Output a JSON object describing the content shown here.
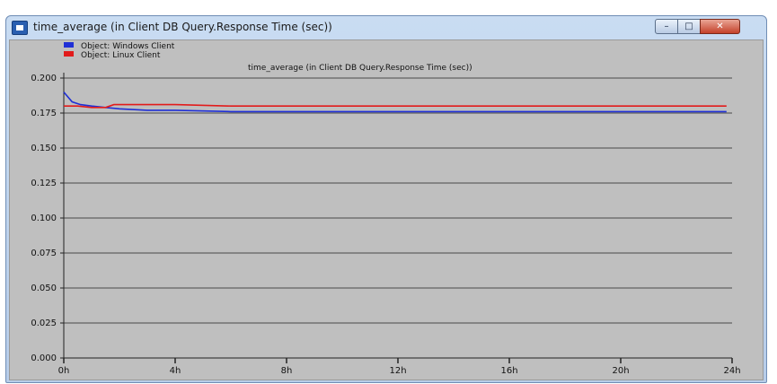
{
  "window": {
    "title": "time_average (in Client DB Query.Response Time (sec))",
    "buttons": {
      "minimize": "–",
      "maximize": "□",
      "close": "✕"
    },
    "icon": "app-icon"
  },
  "legend": [
    {
      "label": "Object: Windows Client",
      "color": "#1f2fd6"
    },
    {
      "label": "Object: Linux Client",
      "color": "#e21b1b"
    }
  ],
  "chart_data": {
    "type": "line",
    "title": "time_average (in Client DB Query.Response Time (sec))",
    "xlabel": "",
    "ylabel": "",
    "xlim": [
      0,
      24
    ],
    "ylim": [
      0,
      0.2
    ],
    "x_ticks": [
      "0h",
      "4h",
      "8h",
      "12h",
      "16h",
      "20h",
      "24h"
    ],
    "y_ticks": [
      "0.000",
      "0.025",
      "0.050",
      "0.075",
      "0.100",
      "0.125",
      "0.150",
      "0.175",
      "0.200"
    ],
    "grid": "horizontal",
    "legend_position": "top-left",
    "series": [
      {
        "name": "Object: Windows Client",
        "color": "#1f2fd6",
        "x": [
          0,
          0.3,
          0.6,
          1,
          1.5,
          2,
          3,
          4,
          6,
          8,
          12,
          16,
          20,
          23.8
        ],
        "y": [
          0.19,
          0.183,
          0.181,
          0.18,
          0.179,
          0.178,
          0.177,
          0.177,
          0.176,
          0.176,
          0.176,
          0.176,
          0.176,
          0.176
        ]
      },
      {
        "name": "Object: Linux Client",
        "color": "#e21b1b",
        "x": [
          0,
          0.5,
          1,
          1.5,
          1.8,
          2,
          3,
          4,
          6,
          8,
          12,
          16,
          20,
          23.8
        ],
        "y": [
          0.18,
          0.18,
          0.179,
          0.179,
          0.181,
          0.181,
          0.181,
          0.181,
          0.18,
          0.18,
          0.18,
          0.18,
          0.18,
          0.18
        ]
      }
    ]
  }
}
